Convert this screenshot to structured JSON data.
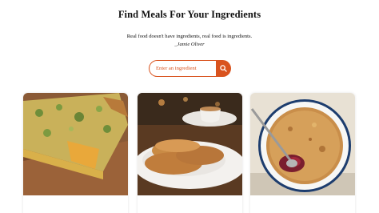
{
  "header": {
    "title": "Find Meals For Your Ingredients",
    "quote": "Real food doesn't have ingredients, real food is ingredients.",
    "author": "_Jamie Oliver"
  },
  "search": {
    "placeholder": "Enter an ingredient",
    "value": "",
    "button_icon": "search-icon",
    "accent_color": "#d9531e"
  },
  "cards": [
    {
      "image": "quiche-slice-image",
      "caption": ""
    },
    {
      "image": "pancakes-plate-image",
      "caption": ""
    },
    {
      "image": "crumble-dish-image",
      "caption": ""
    }
  ]
}
